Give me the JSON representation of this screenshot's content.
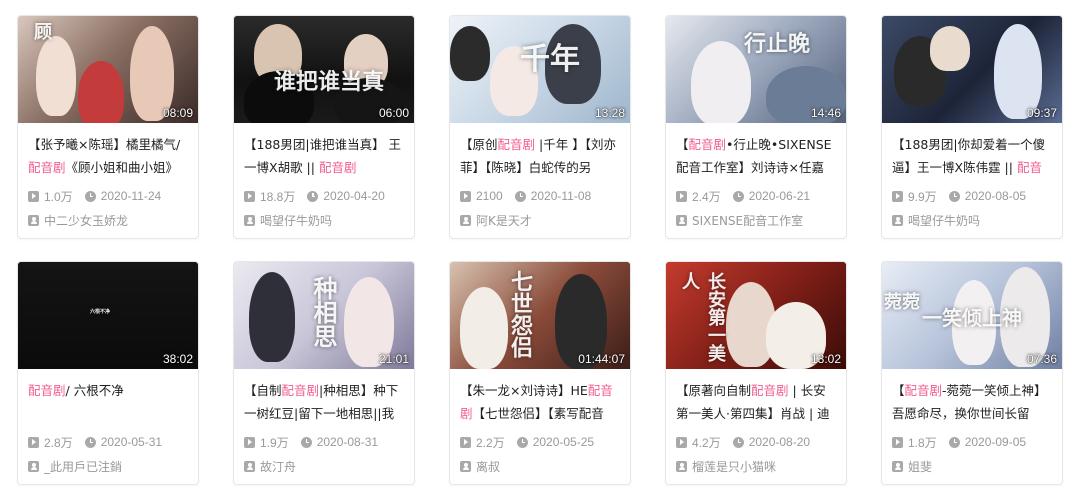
{
  "accent": "#f25d8e",
  "icons": {
    "views": "play-count-icon",
    "date": "clock-icon",
    "uploader": "uploader-icon"
  },
  "videos": [
    {
      "title_parts": [
        {
          "t": "【张予曦×陈瑶】橘里橘气/"
        },
        {
          "t": "配音剧",
          "hl": true
        },
        {
          "t": "《顾小姐和曲小姐》"
        }
      ],
      "duration": "08:09",
      "views": "1.0万",
      "date": "2020-11-24",
      "uploader": "中二少女玉娇龙"
    },
    {
      "title_parts": [
        {
          "t": "【188男团|谁把谁当真】 王一博X胡歌 || "
        },
        {
          "t": "配音剧",
          "hl": true
        }
      ],
      "duration": "06:00",
      "views": "18.8万",
      "date": "2020-04-20",
      "uploader": "喝望仔牛奶吗"
    },
    {
      "title_parts": [
        {
          "t": "【原创"
        },
        {
          "t": "配音剧",
          "hl": true
        },
        {
          "t": " |千年 】【刘亦菲】【陈晓】白蛇传的另"
        }
      ],
      "duration": "13:28",
      "views": "2100",
      "date": "2020-11-08",
      "uploader": "阿K是天才"
    },
    {
      "title_parts": [
        {
          "t": "【"
        },
        {
          "t": "配音剧",
          "hl": true
        },
        {
          "t": "•行止晚•SIXENSE配音工作室】刘诗诗×任嘉"
        }
      ],
      "duration": "14:46",
      "views": "2.4万",
      "date": "2020-06-21",
      "uploader": "SIXENSE配音工作室"
    },
    {
      "title_parts": [
        {
          "t": "【188男团|你却爱着一个傻逼】王一博X陈伟霆 || "
        },
        {
          "t": "配音",
          "hl": true
        }
      ],
      "duration": "09:37",
      "views": "9.9万",
      "date": "2020-08-05",
      "uploader": "喝望仔牛奶吗"
    },
    {
      "title_parts": [
        {
          "t": "配音剧",
          "hl": true
        },
        {
          "t": "/ 六根不净"
        }
      ],
      "duration": "38:02",
      "views": "2.8万",
      "date": "2020-05-31",
      "uploader": "_此用戶已注銷"
    },
    {
      "title_parts": [
        {
          "t": "【自制"
        },
        {
          "t": "配音剧",
          "hl": true
        },
        {
          "t": "|种相思】种下一树红豆|留下一地相思||我"
        }
      ],
      "duration": "21:01",
      "views": "1.9万",
      "date": "2020-08-31",
      "uploader": "故汀舟"
    },
    {
      "title_parts": [
        {
          "t": "【朱一龙×刘诗诗】HE"
        },
        {
          "t": "配音剧",
          "hl": true
        },
        {
          "t": "【七世怨侣】【素写配音"
        }
      ],
      "duration": "01:44:07",
      "views": "2.2万",
      "date": "2020-05-25",
      "uploader": "离叔"
    },
    {
      "title_parts": [
        {
          "t": "【原著向自制"
        },
        {
          "t": "配音剧",
          "hl": true
        },
        {
          "t": " | 长安第一美人·第四集】肖战 | 迪"
        }
      ],
      "duration": "13:02",
      "views": "4.2万",
      "date": "2020-08-20",
      "uploader": "榴莲是只小猫咪"
    },
    {
      "title_parts": [
        {
          "t": "【"
        },
        {
          "t": "配音剧",
          "hl": true
        },
        {
          "t": "-菀菀一笑倾上神】吾愿命尽，换你世间长留"
        }
      ],
      "duration": "07:36",
      "views": "1.8万",
      "date": "2020-09-05",
      "uploader": "姐斐"
    }
  ]
}
